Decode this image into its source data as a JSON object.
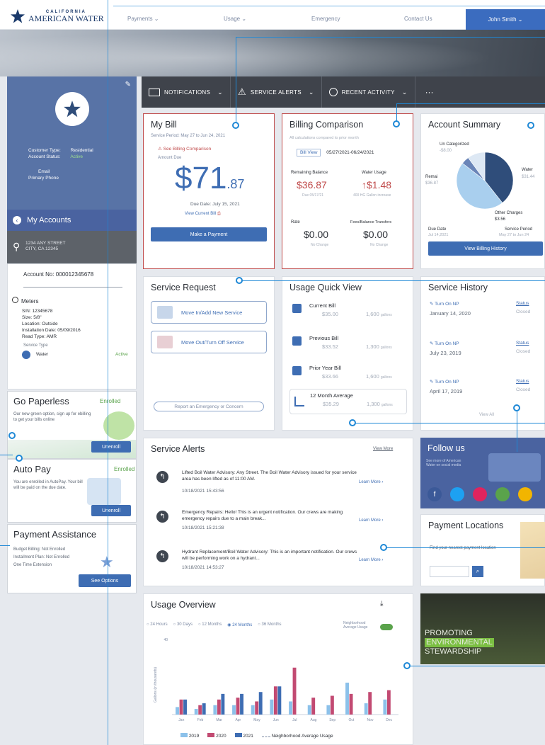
{
  "brand": {
    "line1": "CALIFORNIA",
    "line2": "AMERICAN WATER"
  },
  "nav": {
    "items": [
      "Payments",
      "Usage",
      "Emergency",
      "Contact Us"
    ],
    "user": "John Smith"
  },
  "toolbar": {
    "notifications": "NOTIFICATIONS",
    "service_alerts": "SERVICE ALERTS",
    "recent_activity": "RECENT ACTIVITY",
    "more": "···"
  },
  "profile": {
    "customer_type_label": "Customer Type:",
    "customer_type": "Residential",
    "account_status_label": "Account Status:",
    "account_status": "Active",
    "email_label": "Email",
    "phone_label": "Primary Phone"
  },
  "my_accounts": {
    "title": "My Accounts",
    "address_line1": "1234 ANY STREET",
    "address_line2": "CITY, CA 12345",
    "account_no": "Account No: 000012345678",
    "meters_label": "Meters",
    "meter_details": [
      "S/N: 12345678",
      "Size: 5/8\"",
      "Location: Outside",
      "Installation Date: 05/09/2016",
      "Read Type: AMR"
    ],
    "service_type_label": "Service Type",
    "service_type": "Water",
    "service_status": "Active"
  },
  "go_paperless": {
    "title": "Go Paperless",
    "status": "Enrolled",
    "text": "Our new green option, sign up for ebilling to get your bills online",
    "button": "Unenroll"
  },
  "auto_pay": {
    "title": "Auto Pay",
    "status": "Enrolled",
    "text": "You are enrolled in AutoPay. Your bill will be paid on the due date.",
    "button": "Unenroll"
  },
  "payment_assistance": {
    "title": "Payment Assistance",
    "lines": [
      "Budget Billing: Not Enrolled",
      "Installment Plan: Not Enrolled",
      "One Time Extension"
    ],
    "button": "See Options"
  },
  "my_bill": {
    "title": "My Bill",
    "service_period": "Service Period: May 27 to Jun 24, 2021",
    "comparison_link": "See Billing Comparison",
    "amount_due_label": "Amount Due",
    "amount_main": "$71",
    "amount_cents": ".87",
    "due_date": "Due Date: July 15, 2021",
    "view_bill": "View Current Bill",
    "button": "Make a Payment"
  },
  "billing_comparison": {
    "title": "Billing Comparison",
    "subtitle": "All calculations compared to prior month",
    "bill_view_label": "Bill View",
    "bill_view": "05/27/2021-06/24/2021",
    "remaining_label": "Remaining Balance",
    "remaining_value": "$36.87",
    "remaining_sub": "Due 05/17/21",
    "water_label": "Water Usage",
    "water_value": "↑$1.48",
    "water_sub": "400 HG Gallon increase",
    "rate_label": "Rate",
    "rate_value": "$0.00",
    "rate_sub": "No Change",
    "fees_label": "Fees/Balance Transfers",
    "fees_value": "$0.00",
    "fees_sub": "No Change"
  },
  "account_summary": {
    "title": "Account Summary",
    "uncategorized_label": "Un Categorized",
    "uncategorized": "-$8.00",
    "remaining_label": "Remai",
    "remaining": "$36.87",
    "water_label": "Water",
    "water": "$31.44",
    "other_label": "Other Charges",
    "other": "$3.56",
    "due_date_label": "Due Date",
    "due_date": "Jul 14,2021",
    "service_period_label": "Service Period",
    "service_period": "May 27 to Jun 24",
    "button": "View Billing History",
    "pie": [
      {
        "name": "Water",
        "value": 31.44,
        "color": "#2f4d7a"
      },
      {
        "name": "Remaining",
        "value": 36.87,
        "color": "#a9cfee"
      },
      {
        "name": "Other Charges",
        "value": 3.56,
        "color": "#6a85b8"
      },
      {
        "name": "Un Categorized",
        "value": 8.0,
        "color": "#dde8f4"
      }
    ]
  },
  "service_request": {
    "title": "Service Request",
    "move_in": "Move In/Add New Service",
    "move_out": "Move Out/Turn Off Service",
    "report": "Report an Emergency or Concern"
  },
  "usage_quick_view": {
    "title": "Usage Quick View",
    "rows": [
      {
        "label": "Current Bill",
        "amount": "$35.00",
        "gallons": "1,600",
        "unit": "gallons"
      },
      {
        "label": "Previous Bill",
        "amount": "$33.52",
        "gallons": "1,300",
        "unit": "gallons"
      },
      {
        "label": "Prior Year Bill",
        "amount": "$33.66",
        "gallons": "1,600",
        "unit": "gallons"
      },
      {
        "label": "12 Month Average",
        "amount": "$35.29",
        "gallons": "1,300",
        "unit": "gallons"
      }
    ]
  },
  "service_history": {
    "title": "Service History",
    "rows": [
      {
        "type": "Turn On NP",
        "date": "January 14, 2020",
        "status_label": "Status",
        "status": "Closed"
      },
      {
        "type": "Turn On NP",
        "date": "July 23, 2019",
        "status_label": "Status",
        "status": "Closed"
      },
      {
        "type": "Turn On NP",
        "date": "April 17, 2019",
        "status_label": "Status",
        "status": "Closed"
      }
    ],
    "view_all": "View All"
  },
  "follow_us": {
    "title": "Follow us",
    "text": "See more of American Water on social media"
  },
  "payment_locations": {
    "title": "Payment Locations",
    "placeholder": "Find your nearest payment location"
  },
  "service_alerts": {
    "title": "Service Alerts",
    "view_more": "View More",
    "items": [
      {
        "text": "Lifted Boil Water Advisory: Any Street. The Boil Water Advisory issued for your service area has been lifted as of 11:00 AM.",
        "time": "10/18/2021 15:43:56",
        "link": "Learn More"
      },
      {
        "text": "Emergency Repairs: Hello! This is an urgent notification. Our crews are making emergency repairs due to a main break...",
        "time": "10/18/2021 15:21:38",
        "link": "Learn More"
      },
      {
        "text": "Hydrant Replacement/Boil Water Advisory: This is an important notification. Our crews will be performing work on a hydrant...",
        "time": "10/18/2021 14:53:27",
        "link": "Learn More"
      }
    ]
  },
  "usage_overview": {
    "title": "Usage Overview",
    "ranges": [
      "24 Hours",
      "30 Days",
      "12 Months",
      "24 Months",
      "36 Months"
    ],
    "selected_range": "24 Months",
    "neighborhood_toggle": "Neighborhood Average Usage",
    "legend": [
      "2019",
      "2020",
      "2021",
      "Neighborhood Average Usage"
    ]
  },
  "promo": {
    "line1": "PROMOTING",
    "line2": "ENVIRONMENTAL",
    "line3": "STEWARDSHIP"
  },
  "chart_data": {
    "type": "bar",
    "categories": [
      "Jan",
      "Feb",
      "Mar",
      "Apr",
      "May",
      "Jun",
      "Jul",
      "Aug",
      "Sep",
      "Oct",
      "Nov",
      "Dec"
    ],
    "ylabel": "Gallons (in thousands)",
    "yticks": [
      "40"
    ],
    "ylim": [
      0,
      40
    ],
    "series": [
      {
        "name": "2019",
        "color": "#8cc1ea",
        "values": [
          4,
          3,
          5,
          5,
          5,
          8,
          7,
          5,
          5,
          17,
          6,
          8
        ]
      },
      {
        "name": "2020",
        "color": "#c24a72",
        "values": [
          8,
          5,
          8,
          9,
          7,
          15,
          25,
          9,
          10,
          11,
          12,
          13
        ]
      },
      {
        "name": "2021",
        "color": "#3e6db3",
        "values": [
          8,
          6,
          11,
          11,
          12,
          15,
          0,
          0,
          0,
          0,
          0,
          0
        ]
      }
    ]
  }
}
